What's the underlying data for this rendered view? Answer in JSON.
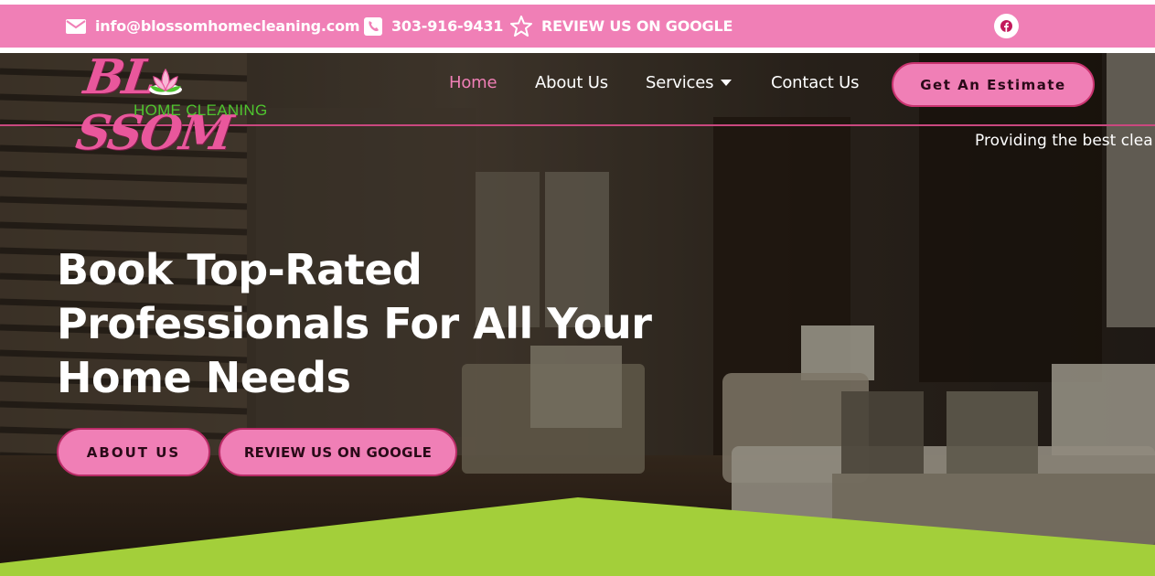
{
  "topbar": {
    "email": "info@blossomhomecleaning.com",
    "phone": "303-916-9431",
    "review": "REVIEW US ON GOOGLE",
    "email_icon": "envelope-icon",
    "phone_icon": "phone-icon",
    "review_icon": "star-icon",
    "social_icon": "facebook-icon"
  },
  "logo": {
    "word": "BL SSOM",
    "sub": "HOME CLEANING"
  },
  "nav": {
    "home": "Home",
    "about": "About Us",
    "services": "Services",
    "contact": "Contact Us",
    "estimate": "Get An Estimate"
  },
  "ticker": "Providing the best clea",
  "hero": {
    "headline": "Book Top-Rated Professionals For All Your Home Needs",
    "about_button": "ABOUT US",
    "review_button": "REVIEW US ON GOOGLE"
  },
  "colors": {
    "brand_pink": "#f07fb6",
    "brand_green": "#a3cf3a",
    "logo_green": "#4fc52f"
  }
}
